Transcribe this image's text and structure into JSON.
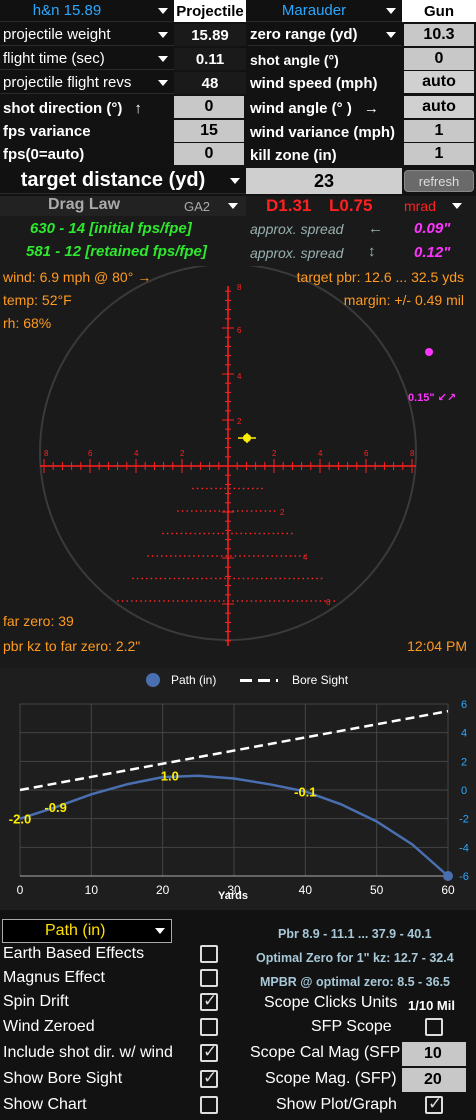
{
  "top_row": {
    "projectile_select": "h&n 15.89",
    "projectile_header": "Projectile",
    "gun_select": "Marauder",
    "gun_header": "Gun"
  },
  "left_fields": [
    {
      "label": "projectile weight",
      "value": "15.89"
    },
    {
      "label": "flight time (sec)",
      "value": "0.11"
    },
    {
      "label": "projectile flight revs",
      "value": "48"
    }
  ],
  "left_inputs": [
    {
      "label": "shot direction (°)",
      "arrow": "↑",
      "value": "0"
    },
    {
      "label": "fps variance",
      "value": "15"
    },
    {
      "label": "fps(0=auto)",
      "value": "0"
    }
  ],
  "right_fields": [
    {
      "label": "zero range (yd)",
      "value": "10.3"
    },
    {
      "label": "shot angle (°)",
      "value": "0"
    },
    {
      "label": "wind speed (mph)",
      "value": "auto"
    },
    {
      "label": "wind angle (° )",
      "arrow": "→",
      "value": "auto"
    },
    {
      "label": "wind variance (mph)",
      "value": "1"
    },
    {
      "label": "kill zone (in)",
      "value": "1"
    }
  ],
  "target": {
    "label": "target distance (yd)",
    "value": "23",
    "refresh": "refresh"
  },
  "drag": {
    "label": "Drag Law",
    "model": "GA2",
    "d_value": "D1.31",
    "l_value": "L0.75",
    "unit": "mrad",
    "initial": "630 - 14 [initial fps/fpe]",
    "retained": "581 - 12 [retained fps/fpe]",
    "spread1_label": "approx. spread",
    "spread1_arrow": "←",
    "spread1_value": "0.09\"",
    "spread2_label": "approx. spread",
    "spread2_arrow": "↕",
    "spread2_value": "0.12\""
  },
  "reticle": {
    "wind": "wind: 6.9 mph @ 80° →",
    "temp": "temp: 52°F",
    "rh": "rh: 68%",
    "pbr": "target pbr: 12.6 ... 32.5 yds",
    "margin": "margin: +/- 0.49 mil",
    "drift": "0.15\" ↙↗",
    "far_zero": "far zero: 39",
    "pbr_kz": "pbr kz to far zero: 2.2\"",
    "time": "12:04 PM",
    "tick_labels_h": [
      "8",
      "6",
      "4",
      "2",
      "2",
      "4",
      "6",
      "8"
    ],
    "tick_labels_v": [
      "8",
      "6",
      "4",
      "2"
    ],
    "tick_labels_below": [
      "2",
      "4",
      "6"
    ]
  },
  "chart_data": {
    "type": "line",
    "series": [
      {
        "name": "Path (in)",
        "x": [
          0,
          5,
          10,
          15,
          20,
          25,
          30,
          35,
          40,
          45,
          50,
          55,
          60
        ],
        "values": [
          -2.0,
          -1.2,
          -0.3,
          0.4,
          0.9,
          1.0,
          0.8,
          0.4,
          -0.1,
          -1.0,
          -2.2,
          -3.8,
          -6.0
        ],
        "color": "#4a6fb0"
      },
      {
        "name": "Bore Sight",
        "x": [
          0,
          60
        ],
        "values": [
          0.0,
          5.5
        ],
        "color": "#ffffff"
      }
    ],
    "data_labels": [
      {
        "x": 0,
        "y": -2.0,
        "text": "-2.0"
      },
      {
        "x": 5,
        "y": -1.2,
        "text": "-0.9"
      },
      {
        "x": 21,
        "y": 1.0,
        "text": "1.0"
      },
      {
        "x": 40,
        "y": -0.1,
        "text": "-0.1"
      }
    ],
    "xlabel": "Yards",
    "xlim": [
      0,
      60
    ],
    "ylim": [
      -6,
      6
    ],
    "x_ticks": [
      "0",
      "10",
      "20",
      "30",
      "40",
      "50",
      "60"
    ],
    "y_ticks": [
      "6",
      "4",
      "2",
      "0",
      "-2",
      "-4",
      "-6"
    ],
    "grid": true,
    "legend": "top-center"
  },
  "settings": {
    "path_select": "Path (in)",
    "options": [
      {
        "label": "Earth Based Effects",
        "checked": false
      },
      {
        "label": "Magnus Effect",
        "checked": false
      },
      {
        "label": "Spin Drift",
        "checked": true
      },
      {
        "label": "Wind Zeroed",
        "checked": false
      },
      {
        "label": "Include shot dir. w/ wind",
        "checked": true
      },
      {
        "label": "Show Bore Sight",
        "checked": true
      },
      {
        "label": "Show Chart",
        "checked": false
      }
    ],
    "pbr_info": "Pbr 8.9 - 11.1 ... 37.9 - 40.1",
    "optimal_zero": "Optimal Zero for 1\" kz: 12.7 - 32.4",
    "mpbr": "MPBR @ optimal zero: 8.5 - 36.5",
    "scope_clicks_label": "Scope Clicks Units",
    "scope_clicks_value": "1/10 Mil",
    "sfp_scope_label": "SFP Scope",
    "scope_cal_label": "Scope Cal Mag (SFP",
    "scope_cal_value": "10",
    "scope_mag_label": "Scope Mag. (SFP)",
    "scope_mag_value": "20",
    "show_plot_label": "Show Plot/Graph"
  }
}
